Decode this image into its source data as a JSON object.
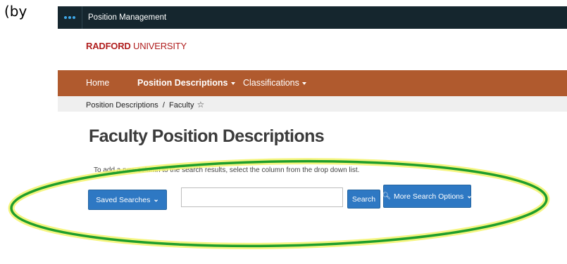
{
  "caption": "(by",
  "topbar": {
    "app_title": "Position Management",
    "menu_icon": "dots-icon"
  },
  "logo": {
    "bold": "RADFORD",
    "rest": " UNIVERSITY"
  },
  "nav": {
    "home": "Home",
    "position_descriptions": "Position Descriptions",
    "classifications": "Classifications"
  },
  "breadcrumb": {
    "text": "Position Descriptions  /  Faculty",
    "favorite_icon": "star-outline-icon"
  },
  "page": {
    "title": "Faculty Position Descriptions",
    "hint": "To add a new column to the search results, select the column from the drop down list."
  },
  "search": {
    "saved_searches_label": "Saved Searches",
    "input_value": "",
    "input_placeholder": "",
    "search_label": "Search",
    "more_options_label": "More Search Options"
  },
  "colors": {
    "topbar": "#15262e",
    "navbar": "#b05a2e",
    "button": "#2e78c3",
    "annotation_ring": "#1f9e2c",
    "annotation_glow": "#f3f36a"
  }
}
